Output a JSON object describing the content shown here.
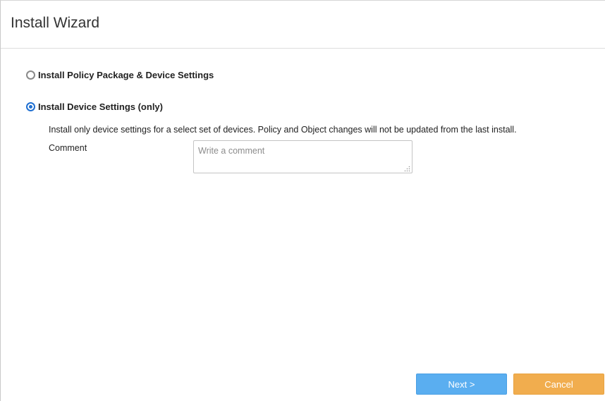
{
  "dialog": {
    "title": "Install Wizard"
  },
  "options": [
    {
      "label": "Install Policy Package & Device Settings",
      "checked": false
    },
    {
      "label": "Install Device Settings (only)",
      "checked": true
    }
  ],
  "selected_option": {
    "description": "Install only device settings for a select set of devices. Policy and Object changes will not be updated from the last install.",
    "comment_label": "Comment",
    "comment_value": "",
    "comment_placeholder": "Write a comment"
  },
  "buttons": {
    "next_label": "Next >",
    "cancel_label": "Cancel"
  },
  "colors": {
    "accent": "#1f6fd1",
    "next_button": "#5aaef0",
    "cancel_button": "#f1ad4e"
  }
}
